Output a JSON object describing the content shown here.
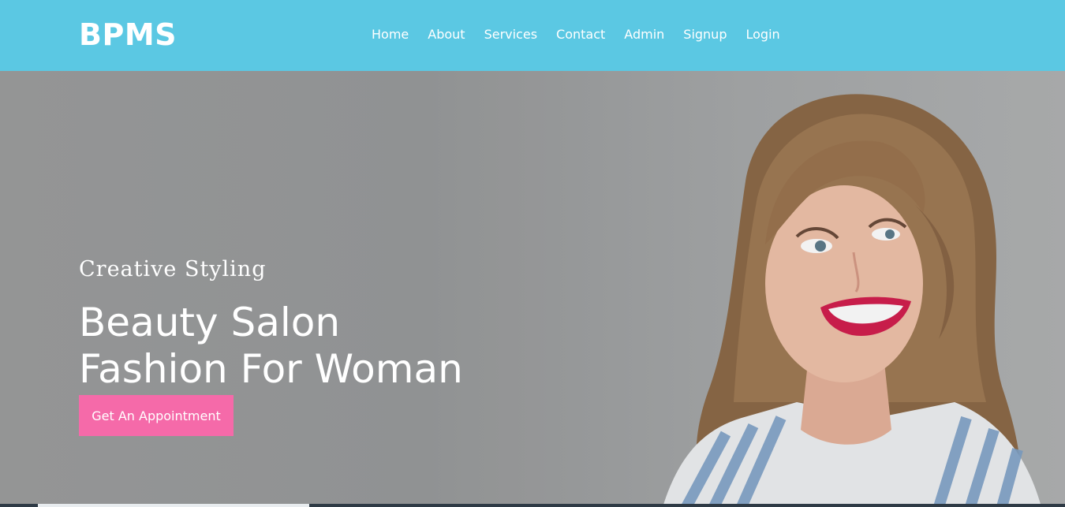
{
  "brand": "BPMS",
  "nav": {
    "items": [
      {
        "label": "Home"
      },
      {
        "label": "About"
      },
      {
        "label": "Services"
      },
      {
        "label": "Contact"
      },
      {
        "label": "Admin"
      },
      {
        "label": "Signup"
      },
      {
        "label": "Login"
      }
    ]
  },
  "hero": {
    "eyebrow": "Creative Styling",
    "headline_line1": "Beauty Salon",
    "headline_line2": "Fashion For Woman",
    "cta_label": "Get An Appointment"
  },
  "colors": {
    "navbar": "#5bc8e3",
    "cta": "#f56aa9",
    "text": "#ffffff"
  }
}
